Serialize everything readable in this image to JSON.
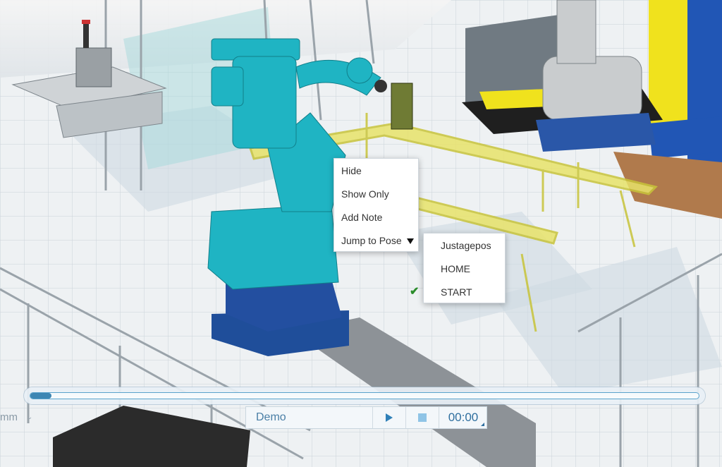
{
  "context_menu": {
    "items": [
      {
        "label": "Hide"
      },
      {
        "label": "Show Only"
      },
      {
        "label": "Add Note"
      },
      {
        "label": "Jump to Pose"
      }
    ]
  },
  "pose_submenu": {
    "items": [
      {
        "label": "Justagepos",
        "checked": false
      },
      {
        "label": "HOME",
        "checked": false
      },
      {
        "label": "START",
        "checked": true
      }
    ]
  },
  "timeline": {
    "progress": 0.03
  },
  "controls": {
    "scenario": "Demo",
    "time": "00:00"
  },
  "units": {
    "label": "mm"
  },
  "icons": {
    "play": "play-icon",
    "stop": "stop-icon",
    "check": "checkmark-icon",
    "submenu": "triangle-down-icon"
  },
  "colors": {
    "robot": "#1fb4c3",
    "robot_base": "#1f4e9a",
    "fixture": "#d9d64a",
    "accent": "#3d86b3"
  }
}
